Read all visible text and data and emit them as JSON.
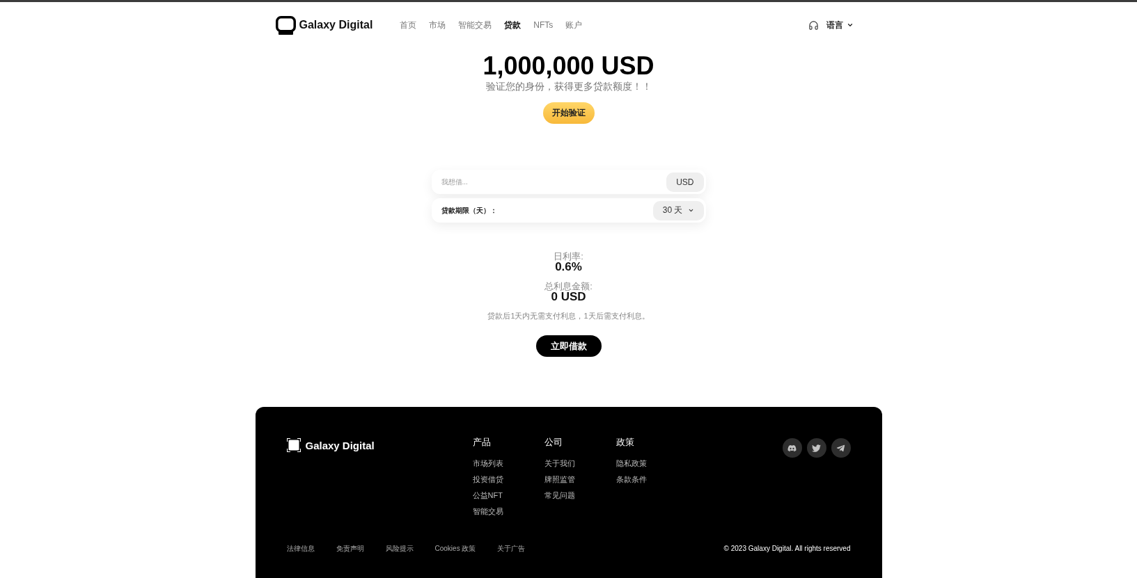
{
  "header": {
    "logo": "Galaxy Digital",
    "nav": [
      {
        "label": "首页",
        "selected": false
      },
      {
        "label": "市场",
        "selected": false
      },
      {
        "label": "智能交易",
        "selected": false
      },
      {
        "label": "贷款",
        "selected": true
      },
      {
        "label": "NFTs",
        "selected": false
      },
      {
        "label": "账户",
        "selected": false
      }
    ],
    "language": "语言"
  },
  "hero": {
    "amount": "1,000,000 USD",
    "subtitle": "验证您的身份，获得更多贷款额度！！",
    "verify_button": "开始验证"
  },
  "loan_form": {
    "amount_field": {
      "placeholder": "我想借...",
      "currency": "USD"
    },
    "term": {
      "label": "贷款期限（天）：",
      "value": "30 天"
    }
  },
  "summary": {
    "stats": [
      {
        "label": "日利率:",
        "value": "0.6%"
      },
      {
        "label": "总利息金额:",
        "value": "0 USD"
      }
    ],
    "note": "贷款后1天内无需支付利息，1天后需支付利息。",
    "borrow_button": "立即借款"
  },
  "footer": {
    "logo": "Galaxy Digital",
    "columns": [
      {
        "title": "产品",
        "links": [
          "市场列表",
          "投资借贷",
          "公益NFT",
          "智能交易"
        ]
      },
      {
        "title": "公司",
        "links": [
          "关于我们",
          "牌照监管",
          "常见问题"
        ]
      },
      {
        "title": "政策",
        "links": [
          "隐私政策",
          "条款条件"
        ]
      }
    ],
    "social": [
      {
        "kind": "discord"
      },
      {
        "kind": "twitter"
      },
      {
        "kind": "telegram"
      }
    ],
    "bottom_links": [
      "法律信息",
      "免责声明",
      "风险提示",
      "Cookies 政策",
      "关于广告"
    ],
    "copyright": "© 2023 Galaxy Digital. All rights reserved"
  }
}
